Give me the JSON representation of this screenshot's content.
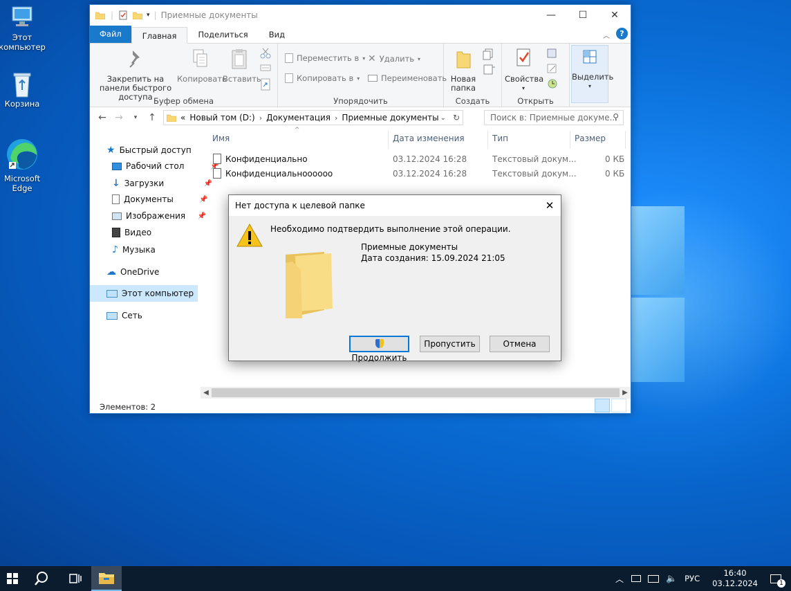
{
  "desktop": {
    "icons": [
      {
        "label": "Этот компьютер",
        "icon": "this-pc-icon"
      },
      {
        "label": "Корзина",
        "icon": "recycle-bin-icon"
      },
      {
        "label": "Microsoft Edge",
        "icon": "edge-icon"
      }
    ]
  },
  "explorer": {
    "title": "Приемные документы",
    "tabs": {
      "file": "Файл",
      "home": "Главная",
      "share": "Поделиться",
      "view": "Вид"
    },
    "ribbon": {
      "pin": "Закрепить на панели быстрого доступа",
      "copy": "Копировать",
      "paste": "Вставить",
      "clipboard_group": "Буфер обмена",
      "move_to": "Переместить в",
      "copy_to": "Копировать в",
      "delete": "Удалить",
      "rename": "Переименовать",
      "organize_group": "Упорядочить",
      "new_folder": "Новая папка",
      "create_group": "Создать",
      "properties": "Свойства",
      "open_group": "Открыть",
      "select": "Выделить"
    },
    "address": {
      "prefix": "«",
      "parts": [
        "Новый том (D:)",
        "Документация",
        "Приемные документы"
      ]
    },
    "search_placeholder": "Поиск в: Приемные докуме...",
    "nav": {
      "quick_access": "Быстрый доступ",
      "desktop": "Рабочий стол",
      "downloads": "Загрузки",
      "documents": "Документы",
      "pictures": "Изображения",
      "video": "Видео",
      "music": "Музыка",
      "onedrive": "OneDrive",
      "this_pc": "Этот компьютер",
      "network": "Сеть"
    },
    "columns": {
      "name": "Имя",
      "date": "Дата изменения",
      "type": "Тип",
      "size": "Размер"
    },
    "files": [
      {
        "name": "Конфиденциально",
        "date": "03.12.2024 16:28",
        "type": "Текстовый докум...",
        "size": "0 КБ"
      },
      {
        "name": "Конфиденциальноооооо",
        "date": "03.12.2024 16:28",
        "type": "Текстовый докум...",
        "size": "0 КБ"
      }
    ],
    "status": "Элементов: 2"
  },
  "dialog": {
    "title": "Нет доступа к целевой папке",
    "message": "Необходимо подтвердить выполнение этой операции.",
    "folder_name": "Приемные документы",
    "created": "Дата создания: 15.09.2024 21:05",
    "buttons": {
      "continue": "Продолжить",
      "skip": "Пропустить",
      "cancel": "Отмена"
    }
  },
  "taskbar": {
    "lang": "РУС",
    "time": "16:40",
    "date": "03.12.2024",
    "notif_count": "1"
  },
  "colors": {
    "accent": "#1979ca",
    "selection": "#cce8ff",
    "taskbar": "#0b1c2e"
  }
}
